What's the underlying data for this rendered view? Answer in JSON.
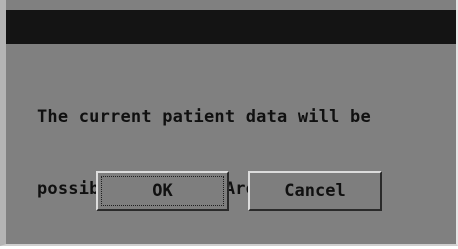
{
  "dialog": {
    "message_line1": "The current patient data will be",
    "message_line2": "possibly cleared! Are you sure?",
    "ok_label": "OK",
    "cancel_label": "Cancel"
  },
  "colors": {
    "dialog_bg": "#808080",
    "titlebar_bg": "#141414",
    "text": "#101010"
  }
}
